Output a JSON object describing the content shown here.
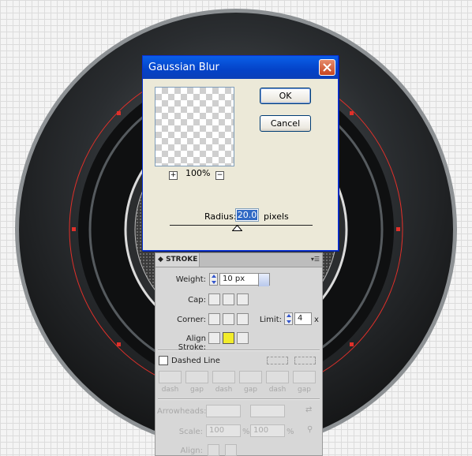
{
  "dialog": {
    "title": "Gaussian Blur",
    "zoom_value": "100%",
    "zoom_in": "+",
    "zoom_out": "−",
    "ok_label": "OK",
    "cancel_label": "Cancel",
    "radius_label": "Radius:",
    "radius_value": "20.0",
    "radius_unit": "pixels"
  },
  "stroke_panel": {
    "tab_label": "STROKE",
    "weight_label": "Weight:",
    "weight_value": "10 px",
    "cap_label": "Cap:",
    "corner_label": "Corner:",
    "limit_label": "Limit:",
    "limit_value": "4",
    "limit_unit": "x",
    "align_label": "Align Stroke:",
    "dashed_label": "Dashed Line",
    "dash_labels": [
      "dash",
      "gap",
      "dash",
      "gap",
      "dash",
      "gap"
    ],
    "arrowheads_label": "Arrowheads:",
    "scale_label": "Scale:",
    "scale_values": [
      "100",
      "100"
    ],
    "percent": "%",
    "align_arrow_label": "Align:"
  },
  "colors": {
    "titlebar": "#0443c8",
    "dialog_bg": "#ece9d8",
    "panel_bg": "#d7d7d7",
    "anchor_red": "#e0302a",
    "active_align": "#f2ec2a"
  }
}
